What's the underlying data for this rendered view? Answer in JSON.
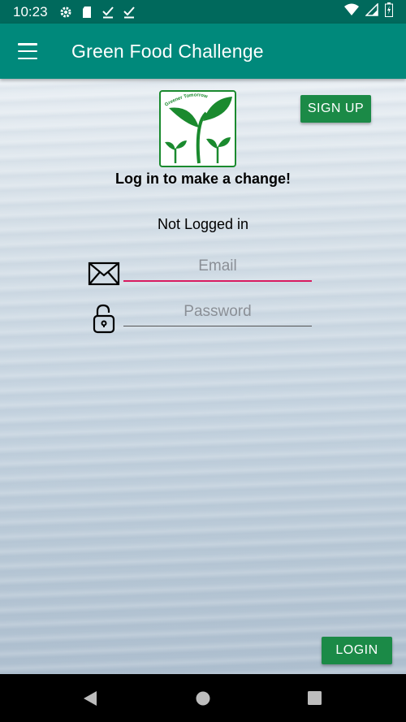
{
  "status_bar": {
    "time": "10:23",
    "icons": [
      "gear-icon",
      "sd-card-icon",
      "download-done-icon",
      "download-done-icon"
    ],
    "right_icons": [
      "wifi-icon",
      "signal-icon",
      "battery-icon"
    ]
  },
  "app_bar": {
    "title": "Green Food Challenge",
    "menu_icon": "hamburger-menu-icon"
  },
  "logo": {
    "text": "Greener Tomorrow",
    "icon": "plant-sprout-logo"
  },
  "buttons": {
    "signup_label": "SIGN UP",
    "login_label": "LOGIN"
  },
  "tagline": "Log in to make a change!",
  "login_status": "Not Logged in",
  "form": {
    "email_placeholder": "Email",
    "password_placeholder": "Password",
    "email_icon": "envelope-icon",
    "password_icon": "unlocked-padlock-icon"
  },
  "colors": {
    "status_bar": "#00695c",
    "app_bar": "#00897b",
    "button": "#1b8a47",
    "email_underline_active": "#d81b60",
    "logo_green": "#1a8a2e"
  },
  "nav_bar": {
    "icons": [
      "back-icon",
      "home-icon",
      "recents-icon"
    ]
  }
}
